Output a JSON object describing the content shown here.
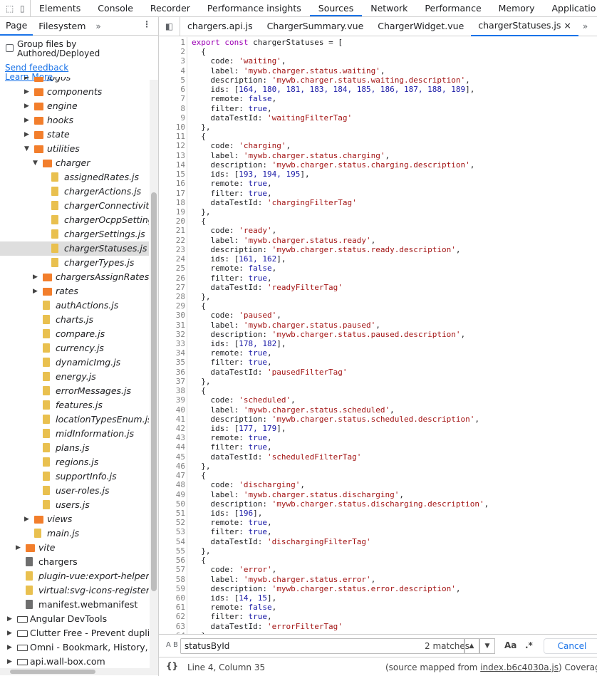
{
  "toolbar": {
    "tabs": [
      "Elements",
      "Console",
      "Recorder",
      "Performance insights",
      "Sources",
      "Network",
      "Performance",
      "Memory",
      "Applicatio"
    ],
    "active_tab": "Sources"
  },
  "sidebar": {
    "tabs": [
      "Page",
      "Filesystem"
    ],
    "more": "»",
    "kebab": "⋮",
    "group_label": "Group files by Authored/Deployed",
    "send_feedback": "Send feedback",
    "learn_more": "Learn More",
    "tree": [
      {
        "label": "logos",
        "type": "folder",
        "depth": 3,
        "expanded": false
      },
      {
        "label": "components",
        "type": "folder",
        "depth": 3,
        "expanded": false
      },
      {
        "label": "engine",
        "type": "folder",
        "depth": 3,
        "expanded": false
      },
      {
        "label": "hooks",
        "type": "folder",
        "depth": 3,
        "expanded": false
      },
      {
        "label": "state",
        "type": "folder",
        "depth": 3,
        "expanded": false
      },
      {
        "label": "utilities",
        "type": "folder",
        "depth": 3,
        "expanded": true
      },
      {
        "label": "charger",
        "type": "folder",
        "depth": 4,
        "expanded": true
      },
      {
        "label": "assignedRates.js",
        "type": "file",
        "depth": 5
      },
      {
        "label": "chargerActions.js",
        "type": "file",
        "depth": 5
      },
      {
        "label": "chargerConnectivity.j",
        "type": "file",
        "depth": 5
      },
      {
        "label": "chargerOcppSettings.",
        "type": "file",
        "depth": 5
      },
      {
        "label": "chargerSettings.js",
        "type": "file",
        "depth": 5
      },
      {
        "label": "chargerStatuses.js",
        "type": "file",
        "depth": 5,
        "selected": true
      },
      {
        "label": "chargerTypes.js",
        "type": "file",
        "depth": 5
      },
      {
        "label": "chargersAssignRates",
        "type": "folder",
        "depth": 4,
        "expanded": false
      },
      {
        "label": "rates",
        "type": "folder",
        "depth": 4,
        "expanded": false
      },
      {
        "label": "authActions.js",
        "type": "file",
        "depth": 4
      },
      {
        "label": "charts.js",
        "type": "file",
        "depth": 4
      },
      {
        "label": "compare.js",
        "type": "file",
        "depth": 4
      },
      {
        "label": "currency.js",
        "type": "file",
        "depth": 4
      },
      {
        "label": "dynamicImg.js",
        "type": "file",
        "depth": 4
      },
      {
        "label": "energy.js",
        "type": "file",
        "depth": 4
      },
      {
        "label": "errorMessages.js",
        "type": "file",
        "depth": 4
      },
      {
        "label": "features.js",
        "type": "file",
        "depth": 4
      },
      {
        "label": "locationTypesEnum.js",
        "type": "file",
        "depth": 4
      },
      {
        "label": "midInformation.js",
        "type": "file",
        "depth": 4
      },
      {
        "label": "plans.js",
        "type": "file",
        "depth": 4
      },
      {
        "label": "regions.js",
        "type": "file",
        "depth": 4
      },
      {
        "label": "supportInfo.js",
        "type": "file",
        "depth": 4
      },
      {
        "label": "user-roles.js",
        "type": "file",
        "depth": 4
      },
      {
        "label": "users.js",
        "type": "file",
        "depth": 4
      },
      {
        "label": "views",
        "type": "folder",
        "depth": 3,
        "expanded": false
      },
      {
        "label": "main.js",
        "type": "file",
        "depth": 3
      },
      {
        "label": "vite",
        "type": "folder",
        "depth": 2,
        "expanded": false
      },
      {
        "label": "chargers",
        "type": "filegrey",
        "depth": 2
      },
      {
        "label": "plugin-vue:export-helper",
        "type": "file",
        "depth": 2
      },
      {
        "label": "virtual:svg-icons-register",
        "type": "file",
        "depth": 2
      },
      {
        "label": "manifest.webmanifest",
        "type": "filegrey",
        "depth": 2
      },
      {
        "label": "Angular DevTools",
        "type": "cloud",
        "depth": 1,
        "expanded": false
      },
      {
        "label": "Clutter Free - Prevent duplica",
        "type": "cloud",
        "depth": 1,
        "expanded": false
      },
      {
        "label": "Omni - Bookmark, History, & T",
        "type": "cloud",
        "depth": 1,
        "expanded": false
      },
      {
        "label": "api.wall-box.com",
        "type": "cloud",
        "depth": 1,
        "expanded": false
      }
    ]
  },
  "editor": {
    "file_tabs": [
      "chargers.api.js",
      "ChargerSummary.vue",
      "ChargerWidget.vue",
      "chargerStatuses.js"
    ],
    "active_file": "chargerStatuses.js",
    "close": "×",
    "more": "»",
    "first_line": "export const chargerStatuses = [",
    "statuses": [
      {
        "code": "waiting",
        "label": "mywb.charger.status.waiting",
        "description": "mywb.charger.status.waiting.description",
        "ids": "164, 180, 181, 183, 184, 185, 186, 187, 188, 189",
        "remote": "false",
        "filter": "true",
        "dataTestId": "waitingFilterTag"
      },
      {
        "code": "charging",
        "label": "mywb.charger.status.charging",
        "description": "mywb.charger.status.charging.description",
        "ids": "193, 194, 195",
        "remote": "true",
        "filter": "true",
        "dataTestId": "chargingFilterTag"
      },
      {
        "code": "ready",
        "label": "mywb.charger.status.ready",
        "description": "mywb.charger.status.ready.description",
        "ids": "161, 162",
        "remote": "false",
        "filter": "true",
        "dataTestId": "readyFilterTag"
      },
      {
        "code": "paused",
        "label": "mywb.charger.status.paused",
        "description": "mywb.charger.status.paused.description",
        "ids": "178, 182",
        "remote": "true",
        "filter": "true",
        "dataTestId": "pausedFilterTag"
      },
      {
        "code": "scheduled",
        "label": "mywb.charger.status.scheduled",
        "description": "mywb.charger.status.scheduled.description",
        "ids": "177, 179",
        "remote": "true",
        "filter": "true",
        "dataTestId": "scheduledFilterTag"
      },
      {
        "code": "discharging",
        "label": "mywb.charger.status.discharging",
        "description": "mywb.charger.status.discharging.description",
        "ids": "196",
        "remote": "true",
        "filter": "true",
        "dataTestId": "dischargingFilterTag"
      },
      {
        "code": "error",
        "label": "mywb.charger.status.error",
        "description": "mywb.charger.status.error.description",
        "ids": "14, 15",
        "remote": "false",
        "filter": "true",
        "dataTestId": "errorFilterTag"
      }
    ]
  },
  "search": {
    "icon": "A B",
    "query": "statusById",
    "matches": "2 matches",
    "up": "▲",
    "down": "▼",
    "match_case": "Aa",
    "regex": ".*",
    "cancel": "Cancel"
  },
  "status_bar": {
    "braces": "{}",
    "position": "Line 4, Column 35",
    "source_prefix": "(source mapped from ",
    "source_file": "index.b6c4030a.js",
    "source_suffix": ")  Coverage: n/a"
  }
}
